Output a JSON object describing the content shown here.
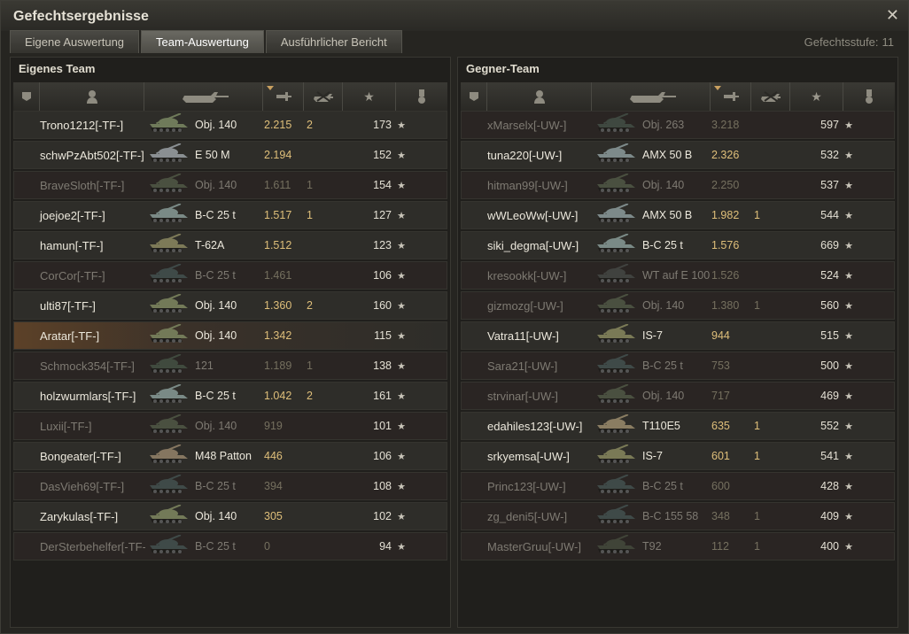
{
  "window": {
    "title": "Gefechtsergebnisse",
    "close_icon": "close-icon"
  },
  "tabs": [
    {
      "label": "Eigene Auswertung",
      "active": false
    },
    {
      "label": "Team-Auswertung",
      "active": true
    },
    {
      "label": "Ausführlicher Bericht",
      "active": false
    }
  ],
  "battle_level": {
    "label": "Gefechtsstufe:",
    "value": "11"
  },
  "columns": [
    {
      "icon": "badge-icon"
    },
    {
      "icon": "player-icon"
    },
    {
      "icon": "tank-icon"
    },
    {
      "icon": "damage-icon",
      "sorted": true
    },
    {
      "icon": "kills-icon"
    },
    {
      "icon": "star-icon"
    },
    {
      "icon": "medal-icon"
    }
  ],
  "own_team": {
    "title": "Eigenes Team",
    "rows": [
      {
        "name": "Trono1212[-TF-]",
        "tank": "Obj. 140",
        "damage": "2.215",
        "kills": "2",
        "xp": "173",
        "dead": false,
        "player": false,
        "tank_color": "#6f7a5a"
      },
      {
        "name": "schwPzAbt502[-TF-]",
        "tank": "E 50 M",
        "damage": "2.194",
        "kills": "",
        "xp": "152",
        "dead": false,
        "player": false,
        "tank_color": "#8a8f92"
      },
      {
        "name": "BraveSloth[-TF-]",
        "tank": "Obj. 140",
        "damage": "1.611",
        "kills": "1",
        "xp": "154",
        "dead": true,
        "player": false,
        "tank_color": "#4a5040"
      },
      {
        "name": "joejoe2[-TF-]",
        "tank": "B-C 25 t",
        "damage": "1.517",
        "kills": "1",
        "xp": "127",
        "dead": false,
        "player": false,
        "tank_color": "#7a8a86"
      },
      {
        "name": "hamun[-TF-]",
        "tank": "T-62A",
        "damage": "1.512",
        "kills": "",
        "xp": "123",
        "dead": false,
        "player": false,
        "tank_color": "#7d7a58"
      },
      {
        "name": "CorCor[-TF-]",
        "tank": "B-C 25 t",
        "damage": "1.461",
        "kills": "",
        "xp": "106",
        "dead": true,
        "player": false,
        "tank_color": "#3f4a48"
      },
      {
        "name": "ulti87[-TF-]",
        "tank": "Obj. 140",
        "damage": "1.360",
        "kills": "2",
        "xp": "160",
        "dead": false,
        "player": false,
        "tank_color": "#737a58"
      },
      {
        "name": "Aratar[-TF-]",
        "tank": "Obj. 140",
        "damage": "1.342",
        "kills": "",
        "xp": "115",
        "dead": false,
        "player": true,
        "tank_color": "#737a58"
      },
      {
        "name": "Schmock354[-TF-]",
        "tank": "121",
        "damage": "1.189",
        "kills": "1",
        "xp": "138",
        "dead": true,
        "player": false,
        "tank_color": "#404a3e"
      },
      {
        "name": "holzwurmlars[-TF-]",
        "tank": "B-C 25 t",
        "damage": "1.042",
        "kills": "2",
        "xp": "161",
        "dead": false,
        "player": false,
        "tank_color": "#7a8a86"
      },
      {
        "name": "Luxii[-TF-]",
        "tank": "Obj. 140",
        "damage": "919",
        "kills": "",
        "xp": "101",
        "dead": true,
        "player": false,
        "tank_color": "#4a5040"
      },
      {
        "name": "Bongeater[-TF-]",
        "tank": "M48 Patton",
        "damage": "446",
        "kills": "",
        "xp": "106",
        "dead": false,
        "player": false,
        "tank_color": "#857660"
      },
      {
        "name": "DasVieh69[-TF-]",
        "tank": "B-C 25 t",
        "damage": "394",
        "kills": "",
        "xp": "108",
        "dead": true,
        "player": false,
        "tank_color": "#3f4a48"
      },
      {
        "name": "Zarykulas[-TF-]",
        "tank": "Obj. 140",
        "damage": "305",
        "kills": "",
        "xp": "102",
        "dead": false,
        "player": false,
        "tank_color": "#737a58"
      },
      {
        "name": "DerSterbehelfer[-TF-]",
        "tank": "B-C 25 t",
        "damage": "0",
        "kills": "",
        "xp": "94",
        "dead": true,
        "player": false,
        "tank_color": "#3f4a48"
      }
    ]
  },
  "enemy_team": {
    "title": "Gegner-Team",
    "rows": [
      {
        "name": "xMarselx[-UW-]",
        "tank": "Obj. 263",
        "damage": "3.218",
        "kills": "",
        "xp": "597",
        "dead": true,
        "player": false,
        "tank_color": "#3f4840"
      },
      {
        "name": "tuna220[-UW-]",
        "tank": "AMX 50 B",
        "damage": "2.326",
        "kills": "",
        "xp": "532",
        "dead": false,
        "player": false,
        "tank_color": "#7d8a8a"
      },
      {
        "name": "hitman99[-UW-]",
        "tank": "Obj. 140",
        "damage": "2.250",
        "kills": "",
        "xp": "537",
        "dead": true,
        "player": false,
        "tank_color": "#4a5040"
      },
      {
        "name": "wWLeoWw[-UW-]",
        "tank": "AMX 50 B",
        "damage": "1.982",
        "kills": "1",
        "xp": "544",
        "dead": false,
        "player": false,
        "tank_color": "#7d8a8a"
      },
      {
        "name": "siki_degma[-UW-]",
        "tank": "B-C 25 t",
        "damage": "1.576",
        "kills": "",
        "xp": "669",
        "dead": false,
        "player": false,
        "tank_color": "#7a8a86"
      },
      {
        "name": "kresookk[-UW-]",
        "tank": "WT auf E 100",
        "damage": "1.526",
        "kills": "",
        "xp": "524",
        "dead": true,
        "player": false,
        "tank_color": "#40423f"
      },
      {
        "name": "gizmozg[-UW-]",
        "tank": "Obj. 140",
        "damage": "1.380",
        "kills": "1",
        "xp": "560",
        "dead": true,
        "player": false,
        "tank_color": "#4a5040"
      },
      {
        "name": "Vatra11[-UW-]",
        "tank": "IS-7",
        "damage": "944",
        "kills": "",
        "xp": "515",
        "dead": false,
        "player": false,
        "tank_color": "#7a7a56"
      },
      {
        "name": "Sara21[-UW-]",
        "tank": "B-C 25 t",
        "damage": "753",
        "kills": "",
        "xp": "500",
        "dead": true,
        "player": false,
        "tank_color": "#3f4a48"
      },
      {
        "name": "strvinar[-UW-]",
        "tank": "Obj. 140",
        "damage": "717",
        "kills": "",
        "xp": "469",
        "dead": true,
        "player": false,
        "tank_color": "#4a5040"
      },
      {
        "name": "edahiles123[-UW-]",
        "tank": "T110E5",
        "damage": "635",
        "kills": "1",
        "xp": "552",
        "dead": false,
        "player": false,
        "tank_color": "#8a7d62"
      },
      {
        "name": "srkyemsa[-UW-]",
        "tank": "IS-7",
        "damage": "601",
        "kills": "1",
        "xp": "541",
        "dead": false,
        "player": false,
        "tank_color": "#7a7a56"
      },
      {
        "name": "Princ123[-UW-]",
        "tank": "B-C 25 t",
        "damage": "600",
        "kills": "",
        "xp": "428",
        "dead": true,
        "player": false,
        "tank_color": "#3f4a48"
      },
      {
        "name": "zg_deni5[-UW-]",
        "tank": "B-C 155 58",
        "damage": "348",
        "kills": "1",
        "xp": "409",
        "dead": true,
        "player": false,
        "tank_color": "#3f4a48"
      },
      {
        "name": "MasterGruu[-UW-]",
        "tank": "T92",
        "damage": "112",
        "kills": "1",
        "xp": "400",
        "dead": true,
        "player": false,
        "tank_color": "#404438"
      }
    ]
  }
}
